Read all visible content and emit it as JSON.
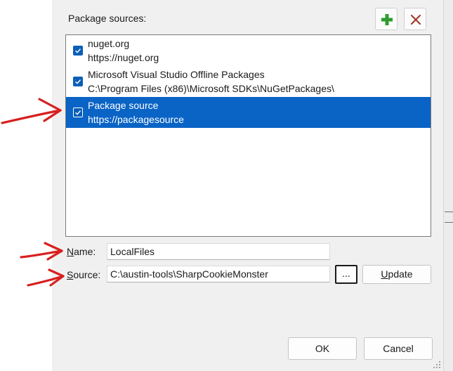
{
  "dialog": {
    "sources_label": "Package sources:",
    "sources": [
      {
        "name": "nuget.org",
        "path": "https://nuget.org",
        "checked": true,
        "selected": false
      },
      {
        "name": "Microsoft Visual Studio Offline Packages",
        "path": "C:\\Program Files (x86)\\Microsoft SDKs\\NuGetPackages\\",
        "checked": true,
        "selected": false
      },
      {
        "name": "Package source",
        "path": "https://packagesource",
        "checked": true,
        "selected": true
      }
    ],
    "name_label_key": "N",
    "name_label_rest": "ame:",
    "name_value": "LocalFiles",
    "source_label_key": "S",
    "source_label_rest": "ource:",
    "source_value": "C:\\austin-tools\\SharpCookieMonster",
    "browse_label": "...",
    "update_label_key": "U",
    "update_label_rest": "pdate",
    "ok_label": "OK",
    "cancel_label": "Cancel"
  },
  "icons": {
    "add": "plus-icon",
    "remove": "x-icon"
  },
  "colors": {
    "selection": "#0a64c6",
    "checkbox": "#0a5fb8",
    "add_icon": "#2e9c2e",
    "remove_icon": "#a33a2e",
    "annotation": "#d81f1f"
  }
}
